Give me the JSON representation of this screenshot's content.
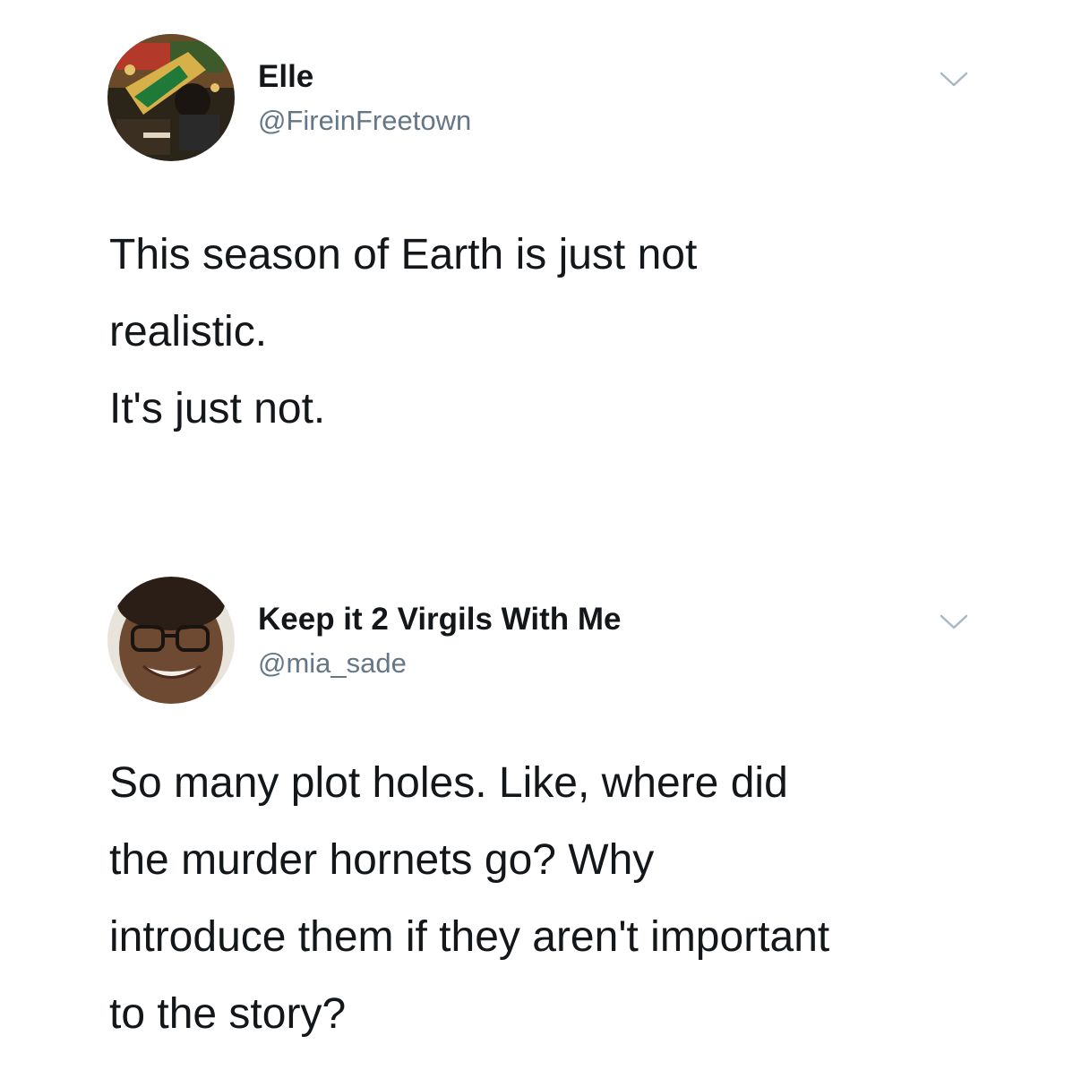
{
  "tweets": [
    {
      "display_name": "Elle",
      "handle": "@FireinFreetown",
      "text_lines": [
        "This season of Earth is just not",
        "realistic.",
        "It's just not."
      ],
      "menu_icon": "chevron-down-icon"
    },
    {
      "display_name": "Keep it 2 Virgils With Me",
      "handle": "@mia_sade",
      "text_lines": [
        "So many plot holes. Like, where did",
        "the murder hornets go? Why",
        "introduce them if they aren't important",
        "to the story?"
      ],
      "menu_icon": "chevron-down-icon"
    }
  ],
  "colors": {
    "background": "#ffffff",
    "text_primary": "#14171a",
    "text_secondary": "#657786",
    "chevron": "#aab8c2"
  }
}
